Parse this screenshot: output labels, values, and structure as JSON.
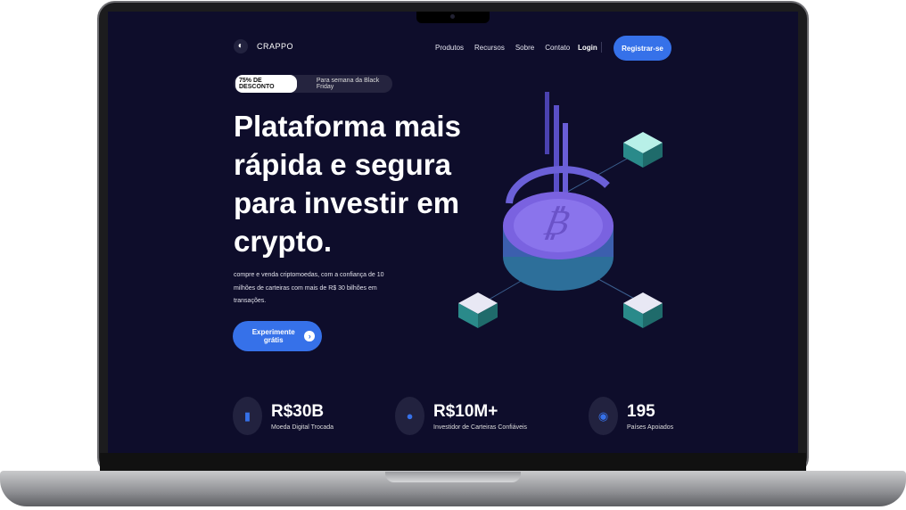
{
  "brand": {
    "name": "CRAPPO"
  },
  "nav": {
    "items": [
      "Produtos",
      "Recursos",
      "Sobre",
      "Contato"
    ],
    "login": "Login",
    "register": "Registrar-se"
  },
  "promo": {
    "badge": "75% DE DESCONTO",
    "text": "Para semana da Black Friday"
  },
  "hero": {
    "title": "Plataforma mais rápida e segura para investir em crypto.",
    "description": "compre e venda criptomoedas, com a confiança de 10 milhões de carteiras com mais de R$ 30 bilhões em transações.",
    "cta": "Experimente grátis"
  },
  "stats": [
    {
      "value": "R$30B",
      "label": "Moeda Digital Trocada",
      "icon": "bar-chart-icon"
    },
    {
      "value": "R$10M+",
      "label": "Investidor de Carteiras Confiáveis",
      "icon": "user-icon"
    },
    {
      "value": "195",
      "label": "Países Apoiados",
      "icon": "globe-icon"
    }
  ],
  "colors": {
    "bg": "#0e0d2b",
    "accent": "#3671e9"
  }
}
